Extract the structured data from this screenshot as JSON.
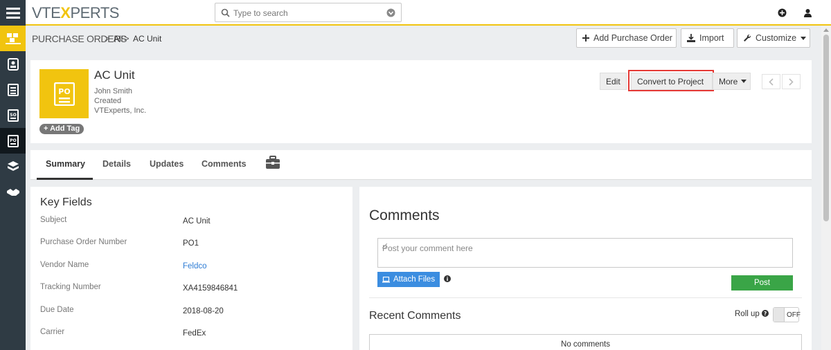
{
  "colors": {
    "accent": "#f1c40f",
    "rail": "#2f3b44",
    "highlight": "#e53935",
    "attach": "#3b8de0",
    "post": "#3aa547",
    "link": "#2c7bd4"
  },
  "header": {
    "logo_left": "VTE",
    "logo_x": "X",
    "logo_right": "PERTS",
    "search_placeholder": "Type to search"
  },
  "breadcrumb": {
    "module": "PURCHASE ORDERS",
    "sep": ">",
    "all": "All",
    "record": "AC Unit"
  },
  "toolbar": {
    "add_label": "Add Purchase Order",
    "import_label": "Import",
    "customize_label": "Customize"
  },
  "record": {
    "icon_text": "PO",
    "title": "AC Unit",
    "owner": "John Smith",
    "status": "Created",
    "company": "VTExperts, Inc.",
    "add_tag": "Add Tag",
    "edit_label": "Edit",
    "convert_label": "Convert to Project",
    "more_label": "More"
  },
  "tabs": [
    "Summary",
    "Details",
    "Updates",
    "Comments"
  ],
  "key_fields": {
    "title": "Key Fields",
    "rows": [
      {
        "label": "Subject",
        "value": "AC Unit"
      },
      {
        "label": "Purchase Order Number",
        "value": "PO1"
      },
      {
        "label": "Vendor Name",
        "value": "Feldco"
      },
      {
        "label": "Tracking Number",
        "value": "XA4159846841"
      },
      {
        "label": "Due Date",
        "value": "2018-08-20"
      },
      {
        "label": "Carrier",
        "value": "FedEx"
      }
    ]
  },
  "comments": {
    "title": "Comments",
    "placeholder": "Post your comment here",
    "attach_label": "Attach Files",
    "post_label": "Post",
    "recent_title": "Recent Comments",
    "rollup_label": "Roll up",
    "toggle_label": "OFF",
    "empty_text": "No comments"
  }
}
